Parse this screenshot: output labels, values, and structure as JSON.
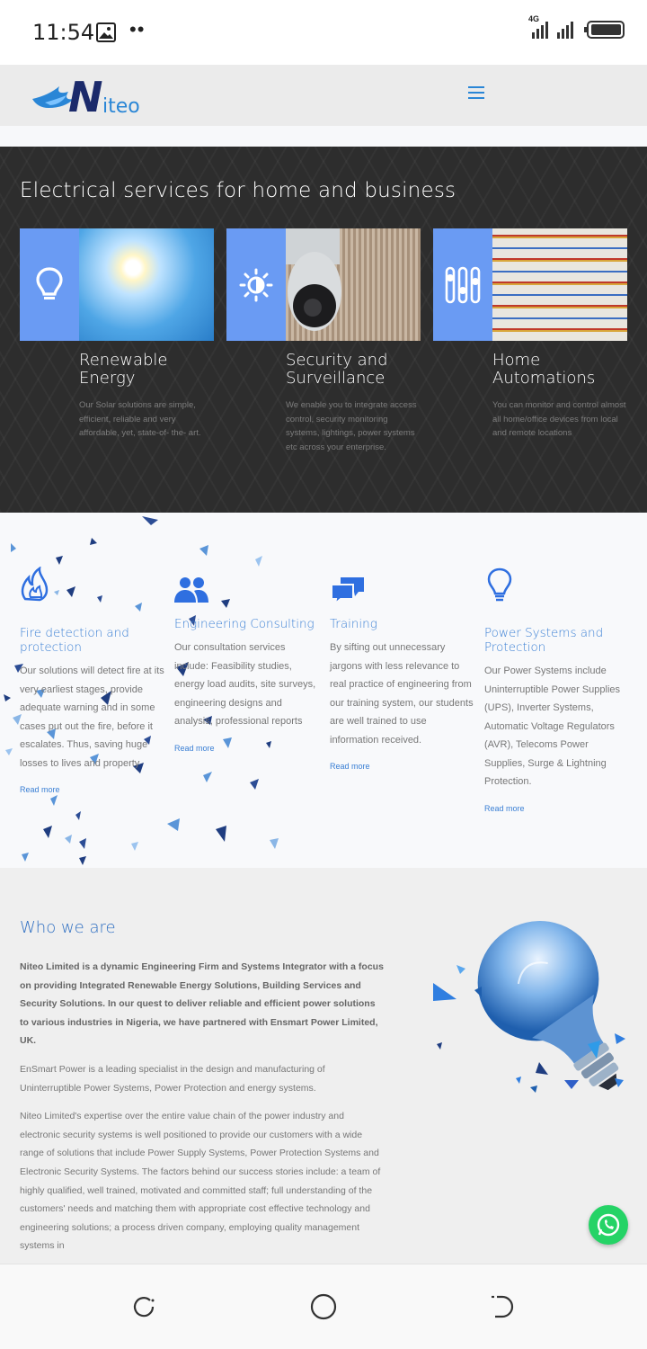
{
  "status": {
    "time": "11:54",
    "network": "4G",
    "dots": "••"
  },
  "header": {
    "logo_text": "iteo",
    "logo_letter": "N"
  },
  "services": {
    "title": "Electrical services for home and business",
    "accent_color": "#6a9bf3",
    "cards": [
      {
        "name": "Renewable Energy",
        "desc": "Our Solar solutions are simple, efficient, reliable and very affordable, yet, state-of- the- art.",
        "icon": "lightbulb-icon"
      },
      {
        "name": "Security and Surveillance",
        "desc": "We enable you to integrate access control, security monitoring systems, lightings, power systems etc across your enterprise.",
        "icon": "sun-icon"
      },
      {
        "name": "Home Automations",
        "desc": "You can monitor and control almost all home/office devices from local and remote locations",
        "icon": "sliders-icon"
      }
    ]
  },
  "features": [
    {
      "title": "Fire detection and protection",
      "desc": "Our solutions will detect fire at its very earliest stages, provide adequate warning and in some cases put out the fire, before it escalates. Thus, saving huge losses to lives and property",
      "link": "Read more",
      "icon": "fire-icon"
    },
    {
      "title": "Engineering Consulting",
      "desc": "Our consultation services include: Feasibility studies, energy load audits, site surveys, engineering designs and analysis, professional reports",
      "link": "Read more",
      "icon": "users-icon"
    },
    {
      "title": "Training",
      "desc": "By sifting out unnecessary jargons with less relevance to real practice of engineering from our training system, our students are well trained to use information received.",
      "link": "Read more",
      "icon": "chat-icon"
    },
    {
      "title": "Power Systems and Protection",
      "desc": "Our Power Systems include Uninterruptible Power Supplies (UPS), Inverter Systems, Automatic Voltage Regulators (AVR), Telecoms Power Supplies, Surge & Lightning Protection.",
      "link": "Read more",
      "icon": "lightbulb-outline-icon"
    }
  ],
  "about": {
    "title": "Who we are",
    "p1": "Niteo Limited is a dynamic Engineering Firm and Systems Integrator with a focus on providing Integrated Renewable Energy Solutions, Building Services and Security Solutions. In our quest to deliver reliable and efficient power solutions to various industries in Nigeria, we have partnered with Ensmart Power Limited, UK.",
    "p2": "EnSmart Power is a leading specialist in the design and manufacturing of Uninterruptible Power Systems, Power Protection and energy systems.",
    "p3": "Niteo Limited's expertise over the entire value chain of the power industry and electronic security systems is well positioned to provide our customers with a wide range of solutions that include Power Supply Systems, Power Protection Systems and Electronic Security Systems. The factors behind our success stories include: a team of highly qualified, well trained, motivated and committed staff; full understanding of the customers' needs and matching them with appropriate cost effective technology and engineering solutions; a process driven company, employing quality management systems in"
  },
  "colors": {
    "brand_blue": "#2a86d6",
    "whatsapp_green": "#25d366"
  }
}
